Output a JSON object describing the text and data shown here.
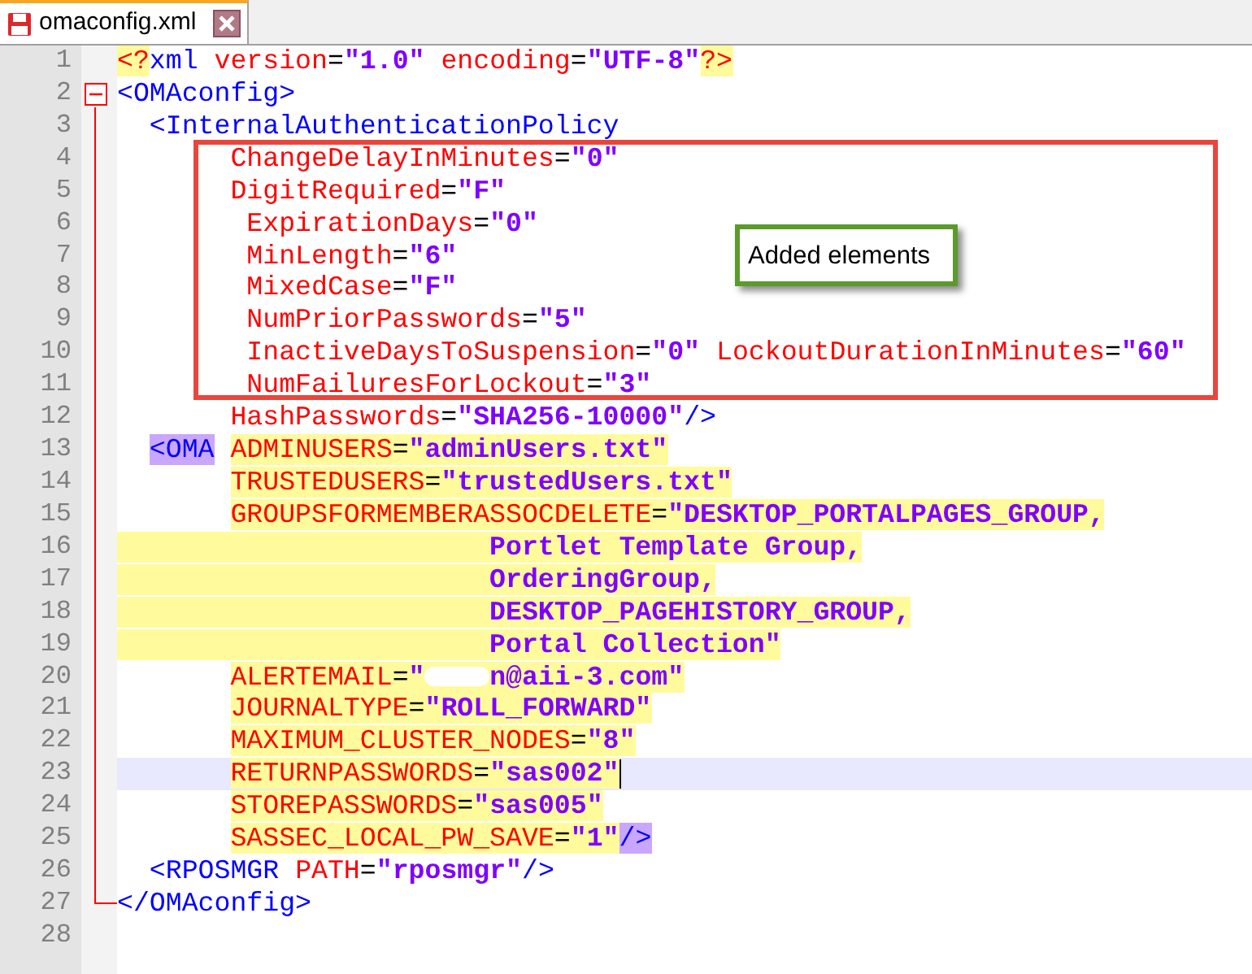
{
  "tabs": [
    {
      "label": "omaconfig.xml",
      "selected": true,
      "modified": true
    }
  ],
  "lines": [
    {
      "number": "1",
      "kind": "code",
      "fold_marker": false,
      "in_fold": false,
      "fold_end": false,
      "current": false,
      "tokens": [
        {
          "kind": "punct",
          "text": "<?",
          "highlighted": true,
          "matched": false
        },
        {
          "kind": "tag",
          "text": "xml",
          "highlighted": false,
          "matched": false
        },
        {
          "kind": "attr",
          "text": " version",
          "highlighted": false,
          "matched": false
        },
        {
          "kind": "eq",
          "text": "=",
          "highlighted": false,
          "matched": false
        },
        {
          "kind": "val",
          "text": "\"1.0\"",
          "highlighted": false,
          "matched": false
        },
        {
          "kind": "attr",
          "text": " encoding",
          "highlighted": false,
          "matched": false
        },
        {
          "kind": "eq",
          "text": "=",
          "highlighted": false,
          "matched": false
        },
        {
          "kind": "val",
          "text": "\"UTF-8\"",
          "highlighted": false,
          "matched": false
        },
        {
          "kind": "punct",
          "text": "?>",
          "highlighted": true,
          "matched": false
        }
      ]
    },
    {
      "number": "2",
      "kind": "code",
      "fold_marker": true,
      "in_fold": false,
      "fold_end": false,
      "current": false,
      "tokens": [
        {
          "kind": "tag",
          "text": "<OMAconfig>",
          "highlighted": false,
          "matched": false
        }
      ]
    },
    {
      "number": "3",
      "kind": "code",
      "fold_marker": false,
      "in_fold": true,
      "fold_end": false,
      "current": false,
      "tokens": [
        {
          "kind": "tag",
          "text": "  <InternalAuthenticationPolicy",
          "highlighted": false,
          "matched": false
        }
      ]
    },
    {
      "number": "4",
      "kind": "code",
      "fold_marker": false,
      "in_fold": true,
      "fold_end": false,
      "current": false,
      "tokens": [
        {
          "kind": "attr",
          "text": "       ChangeDelayInMinutes",
          "highlighted": false,
          "matched": false
        },
        {
          "kind": "eq",
          "text": "=",
          "highlighted": false,
          "matched": false
        },
        {
          "kind": "val",
          "text": "\"0\"",
          "highlighted": false,
          "matched": false
        }
      ]
    },
    {
      "number": "5",
      "kind": "code",
      "fold_marker": false,
      "in_fold": true,
      "fold_end": false,
      "current": false,
      "tokens": [
        {
          "kind": "attr",
          "text": "       DigitRequired",
          "highlighted": false,
          "matched": false
        },
        {
          "kind": "eq",
          "text": "=",
          "highlighted": false,
          "matched": false
        },
        {
          "kind": "val",
          "text": "\"F\"",
          "highlighted": false,
          "matched": false
        }
      ]
    },
    {
      "number": "6",
      "kind": "code",
      "fold_marker": false,
      "in_fold": true,
      "fold_end": false,
      "current": false,
      "tokens": [
        {
          "kind": "attr",
          "text": "        ExpirationDays",
          "highlighted": false,
          "matched": false
        },
        {
          "kind": "eq",
          "text": "=",
          "highlighted": false,
          "matched": false
        },
        {
          "kind": "val",
          "text": "\"0\"",
          "highlighted": false,
          "matched": false
        }
      ]
    },
    {
      "number": "7",
      "kind": "code",
      "fold_marker": false,
      "in_fold": true,
      "fold_end": false,
      "current": false,
      "tokens": [
        {
          "kind": "attr",
          "text": "        MinLength",
          "highlighted": false,
          "matched": false
        },
        {
          "kind": "eq",
          "text": "=",
          "highlighted": false,
          "matched": false
        },
        {
          "kind": "val",
          "text": "\"6\"",
          "highlighted": false,
          "matched": false
        }
      ]
    },
    {
      "number": "8",
      "kind": "code",
      "fold_marker": false,
      "in_fold": true,
      "fold_end": false,
      "current": false,
      "tokens": [
        {
          "kind": "attr",
          "text": "        MixedCase",
          "highlighted": false,
          "matched": false
        },
        {
          "kind": "eq",
          "text": "=",
          "highlighted": false,
          "matched": false
        },
        {
          "kind": "val",
          "text": "\"F\"",
          "highlighted": false,
          "matched": false
        }
      ]
    },
    {
      "number": "9",
      "kind": "code",
      "fold_marker": false,
      "in_fold": true,
      "fold_end": false,
      "current": false,
      "tokens": [
        {
          "kind": "attr",
          "text": "        NumPriorPasswords",
          "highlighted": false,
          "matched": false
        },
        {
          "kind": "eq",
          "text": "=",
          "highlighted": false,
          "matched": false
        },
        {
          "kind": "val",
          "text": "\"5\"",
          "highlighted": false,
          "matched": false
        }
      ]
    },
    {
      "number": "10",
      "kind": "code",
      "fold_marker": false,
      "in_fold": true,
      "fold_end": false,
      "current": false,
      "tokens": [
        {
          "kind": "attr",
          "text": "        InactiveDaysToSuspension",
          "highlighted": false,
          "matched": false
        },
        {
          "kind": "eq",
          "text": "=",
          "highlighted": false,
          "matched": false
        },
        {
          "kind": "val",
          "text": "\"0\"",
          "highlighted": false,
          "matched": false
        },
        {
          "kind": "attr",
          "text": " LockoutDurationInMinutes",
          "highlighted": false,
          "matched": false
        },
        {
          "kind": "eq",
          "text": "=",
          "highlighted": false,
          "matched": false
        },
        {
          "kind": "val",
          "text": "\"60\"",
          "highlighted": false,
          "matched": false
        }
      ]
    },
    {
      "number": "11",
      "kind": "code",
      "fold_marker": false,
      "in_fold": true,
      "fold_end": false,
      "current": false,
      "tokens": [
        {
          "kind": "attr",
          "text": "        NumFailuresForLockout",
          "highlighted": false,
          "matched": false
        },
        {
          "kind": "eq",
          "text": "=",
          "highlighted": false,
          "matched": false
        },
        {
          "kind": "val",
          "text": "\"3\"",
          "highlighted": false,
          "matched": false
        }
      ]
    },
    {
      "number": "12",
      "kind": "code",
      "fold_marker": false,
      "in_fold": true,
      "fold_end": false,
      "current": false,
      "tokens": [
        {
          "kind": "attr",
          "text": "       HashPasswords",
          "highlighted": false,
          "matched": false
        },
        {
          "kind": "eq",
          "text": "=",
          "highlighted": false,
          "matched": false
        },
        {
          "kind": "val",
          "text": "\"SHA256-10000\"",
          "highlighted": false,
          "matched": false
        },
        {
          "kind": "tag",
          "text": "/>",
          "highlighted": false,
          "matched": false
        }
      ]
    },
    {
      "number": "13",
      "kind": "code",
      "fold_marker": false,
      "in_fold": true,
      "fold_end": false,
      "current": false,
      "tokens": [
        {
          "kind": "tag",
          "text": "  <OMA",
          "highlighted": false,
          "matched": true
        },
        {
          "kind": "attr",
          "text": " ADMINUSERS",
          "highlighted": true,
          "matched": false
        },
        {
          "kind": "eq",
          "text": "=",
          "highlighted": true,
          "matched": false
        },
        {
          "kind": "val",
          "text": "\"adminUsers.txt\"",
          "highlighted": true,
          "matched": false
        }
      ]
    },
    {
      "number": "14",
      "kind": "code",
      "fold_marker": false,
      "in_fold": true,
      "fold_end": false,
      "current": false,
      "tokens": [
        {
          "kind": "attr",
          "text": "       TRUSTEDUSERS",
          "highlighted": true,
          "matched": false
        },
        {
          "kind": "eq",
          "text": "=",
          "highlighted": true,
          "matched": false
        },
        {
          "kind": "val",
          "text": "\"trustedUsers.txt\"",
          "highlighted": true,
          "matched": false
        }
      ]
    },
    {
      "number": "15",
      "kind": "code",
      "fold_marker": false,
      "in_fold": true,
      "fold_end": false,
      "current": false,
      "tokens": [
        {
          "kind": "attr",
          "text": "       GROUPSFORMEMBERASSOCDELETE",
          "highlighted": true,
          "matched": false
        },
        {
          "kind": "eq",
          "text": "=",
          "highlighted": true,
          "matched": false
        },
        {
          "kind": "val",
          "text": "\"DESKTOP_PORTALPAGES_GROUP,",
          "highlighted": true,
          "matched": false
        }
      ]
    },
    {
      "number": "16",
      "kind": "continuation",
      "fold_marker": false,
      "in_fold": true,
      "fold_end": false,
      "current": false,
      "tokens": [
        {
          "kind": "val",
          "text": "Portlet Template Group,",
          "highlighted": true,
          "matched": false
        }
      ]
    },
    {
      "number": "17",
      "kind": "continuation",
      "fold_marker": false,
      "in_fold": true,
      "fold_end": false,
      "current": false,
      "tokens": [
        {
          "kind": "val",
          "text": "OrderingGroup,",
          "highlighted": true,
          "matched": false
        }
      ]
    },
    {
      "number": "18",
      "kind": "continuation",
      "fold_marker": false,
      "in_fold": true,
      "fold_end": false,
      "current": false,
      "tokens": [
        {
          "kind": "val",
          "text": "DESKTOP_PAGEHISTORY_GROUP,",
          "highlighted": true,
          "matched": false
        }
      ]
    },
    {
      "number": "19",
      "kind": "continuation",
      "fold_marker": false,
      "in_fold": true,
      "fold_end": false,
      "current": false,
      "tokens": [
        {
          "kind": "val",
          "text": "Portal Collection\"",
          "highlighted": true,
          "matched": false
        }
      ]
    },
    {
      "number": "20",
      "kind": "code",
      "fold_marker": false,
      "in_fold": true,
      "fold_end": false,
      "current": false,
      "tokens": [
        {
          "kind": "attr",
          "text": "       ALERTEMAIL",
          "highlighted": true,
          "matched": false
        },
        {
          "kind": "eq",
          "text": "=",
          "highlighted": true,
          "matched": false
        },
        {
          "kind": "val",
          "text": "\"",
          "highlighted": true,
          "matched": false
        },
        {
          "kind": "redacted",
          "highlighted": true,
          "matched": false
        },
        {
          "kind": "val",
          "text": "n@aii-3.com\"",
          "highlighted": true,
          "matched": false
        }
      ]
    },
    {
      "number": "21",
      "kind": "code",
      "fold_marker": false,
      "in_fold": true,
      "fold_end": false,
      "current": false,
      "tokens": [
        {
          "kind": "attr",
          "text": "       JOURNALTYPE",
          "highlighted": true,
          "matched": false
        },
        {
          "kind": "eq",
          "text": "=",
          "highlighted": true,
          "matched": false
        },
        {
          "kind": "val",
          "text": "\"ROLL_FORWARD\"",
          "highlighted": true,
          "matched": false
        }
      ]
    },
    {
      "number": "22",
      "kind": "code",
      "fold_marker": false,
      "in_fold": true,
      "fold_end": false,
      "current": false,
      "tokens": [
        {
          "kind": "attr",
          "text": "       MAXIMUM_CLUSTER_NODES",
          "highlighted": true,
          "matched": false
        },
        {
          "kind": "eq",
          "text": "=",
          "highlighted": true,
          "matched": false
        },
        {
          "kind": "val",
          "text": "\"8\"",
          "highlighted": true,
          "matched": false
        }
      ]
    },
    {
      "number": "23",
      "kind": "code",
      "fold_marker": false,
      "in_fold": true,
      "fold_end": false,
      "current": true,
      "tokens": [
        {
          "kind": "attr",
          "text": "       RETURNPASSWORDS",
          "highlighted": true,
          "matched": false
        },
        {
          "kind": "eq",
          "text": "=",
          "highlighted": true,
          "matched": false
        },
        {
          "kind": "val",
          "text": "\"sas002\"",
          "highlighted": true,
          "matched": false
        }
      ]
    },
    {
      "number": "24",
      "kind": "code",
      "fold_marker": false,
      "in_fold": true,
      "fold_end": false,
      "current": false,
      "tokens": [
        {
          "kind": "attr",
          "text": "       STOREPASSWORDS",
          "highlighted": true,
          "matched": false
        },
        {
          "kind": "eq",
          "text": "=",
          "highlighted": true,
          "matched": false
        },
        {
          "kind": "val",
          "text": "\"sas005\"",
          "highlighted": true,
          "matched": false
        }
      ]
    },
    {
      "number": "25",
      "kind": "code",
      "fold_marker": false,
      "in_fold": true,
      "fold_end": false,
      "current": false,
      "tokens": [
        {
          "kind": "attr",
          "text": "       SASSEC_LOCAL_PW_SAVE",
          "highlighted": true,
          "matched": false
        },
        {
          "kind": "eq",
          "text": "=",
          "highlighted": true,
          "matched": false
        },
        {
          "kind": "val",
          "text": "\"1\"",
          "highlighted": true,
          "matched": false
        },
        {
          "kind": "tag",
          "text": "/>",
          "highlighted": false,
          "matched": true
        }
      ]
    },
    {
      "number": "26",
      "kind": "code",
      "fold_marker": false,
      "in_fold": true,
      "fold_end": false,
      "current": false,
      "tokens": [
        {
          "kind": "tag",
          "text": "  <RPOSMGR",
          "highlighted": false,
          "matched": false
        },
        {
          "kind": "attr",
          "text": " PATH",
          "highlighted": false,
          "matched": false
        },
        {
          "kind": "eq",
          "text": "=",
          "highlighted": false,
          "matched": false
        },
        {
          "kind": "val",
          "text": "\"rposmgr\"",
          "highlighted": false,
          "matched": false
        },
        {
          "kind": "tag",
          "text": "/>",
          "highlighted": false,
          "matched": false
        }
      ]
    },
    {
      "number": "27",
      "kind": "code",
      "fold_marker": false,
      "in_fold": false,
      "fold_end": true,
      "current": false,
      "tokens": [
        {
          "kind": "tag",
          "text": "</OMAconfig>",
          "highlighted": false,
          "matched": false
        }
      ]
    },
    {
      "number": "28",
      "kind": "code",
      "fold_marker": false,
      "in_fold": false,
      "fold_end": false,
      "current": false
    }
  ],
  "annotations": [
    {
      "kind": "frame"
    },
    {
      "kind": "callout",
      "text": "Added elements"
    }
  ]
}
